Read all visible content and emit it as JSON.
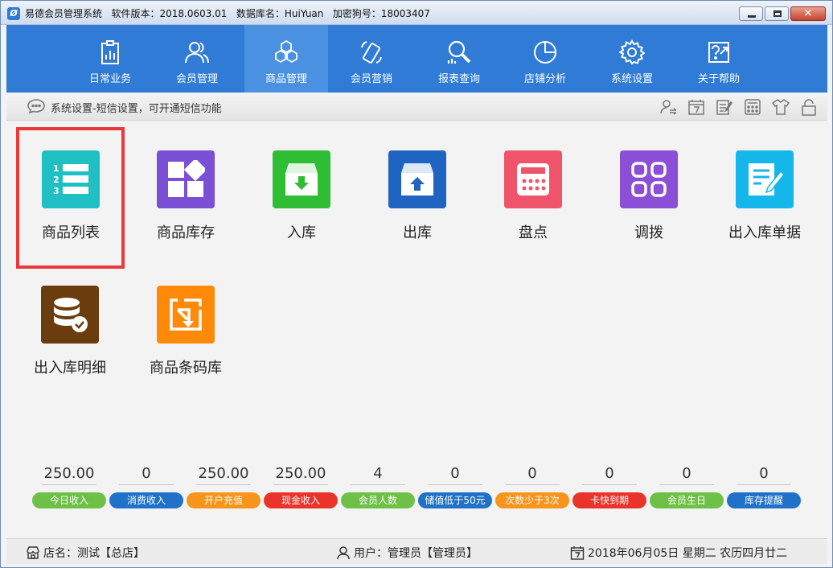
{
  "window": {
    "app_name": "易德会员管理系统",
    "version": "软件版本：2018.0603.01",
    "database": "数据库名：HuiYuan",
    "dongle": "加密狗号：18003407"
  },
  "nav": {
    "items": [
      {
        "label": "日常业务",
        "icon": "clipboard-chart-icon"
      },
      {
        "label": "会员管理",
        "icon": "users-icon"
      },
      {
        "label": "商品管理",
        "icon": "cubes-icon"
      },
      {
        "label": "会员营销",
        "icon": "phone-icon"
      },
      {
        "label": "报表查询",
        "icon": "search-chart-icon"
      },
      {
        "label": "店铺分析",
        "icon": "pie-chart-icon"
      },
      {
        "label": "系统设置",
        "icon": "gear-icon"
      },
      {
        "label": "关于帮助",
        "icon": "help-icon"
      }
    ],
    "active_index": 2,
    "active_color": "#4a91e2",
    "bar_color": "#2f7bd6"
  },
  "infobar": {
    "message": "系统设置-短信设置，可开通短信功能",
    "tools": [
      "user-switch-icon",
      "calendar-icon",
      "notes-icon",
      "calculator-icon",
      "shirt-icon",
      "lock-icon"
    ]
  },
  "modules": [
    {
      "label": "商品列表",
      "color": "#1fbfc4",
      "icon": "numbered-list-icon"
    },
    {
      "label": "商品库存",
      "color": "#7b4fd6",
      "icon": "blocks-icon"
    },
    {
      "label": "入库",
      "color": "#2fbe33",
      "icon": "inbox-in-icon"
    },
    {
      "label": "出库",
      "color": "#1f64c0",
      "icon": "inbox-out-icon"
    },
    {
      "label": "盘点",
      "color": "#f0546a",
      "icon": "calculator-icon"
    },
    {
      "label": "调拨",
      "color": "#8a4fd6",
      "icon": "apps-icon"
    },
    {
      "label": "出入库单据",
      "color": "#15b6ea",
      "icon": "document-edit-icon"
    },
    {
      "label": "出入库明细",
      "color": "#6b3d0e",
      "icon": "database-check-icon"
    },
    {
      "label": "商品条码库",
      "color": "#ff8a0a",
      "icon": "barcode-import-icon"
    }
  ],
  "selected_module_index": 0,
  "stats": [
    {
      "value": "250.00",
      "label": "今日收入",
      "color": "#6cc146"
    },
    {
      "value": "0",
      "label": "消费收入",
      "color": "#1f72c8"
    },
    {
      "value": "250.00",
      "label": "开户充值",
      "color": "#f6941c"
    },
    {
      "value": "250.00",
      "label": "现金收入",
      "color": "#e9332b"
    },
    {
      "value": "4",
      "label": "会员人数",
      "color": "#6cc146"
    },
    {
      "value": "0",
      "label": "储值低于50元",
      "color": "#1f72c8"
    },
    {
      "value": "0",
      "label": "次数少于3次",
      "color": "#f6941c"
    },
    {
      "value": "0",
      "label": "卡快到期",
      "color": "#e9332b"
    },
    {
      "value": "0",
      "label": "会员生日",
      "color": "#6cc146"
    },
    {
      "value": "0",
      "label": "库存提醒",
      "color": "#1f72c8"
    }
  ],
  "status": {
    "shop": "店名：测试【总店】",
    "user": "用户：管理员【管理员】",
    "date": "2018年06月05日 星期二 农历四月廿二"
  }
}
